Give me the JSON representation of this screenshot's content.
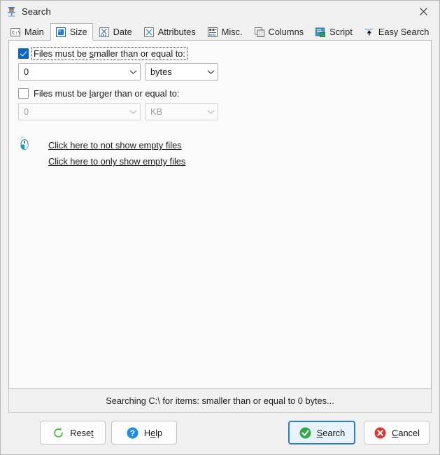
{
  "window": {
    "title": "Search",
    "icon": "search-filter-icon",
    "close_label": "×"
  },
  "tabs": [
    {
      "label": "Main",
      "icon": "console-prompt-icon",
      "selected": false
    },
    {
      "label": "Size",
      "icon": "resize-icon",
      "selected": true
    },
    {
      "label": "Date",
      "icon": "calendar-chart-icon",
      "selected": false
    },
    {
      "label": "Attributes",
      "icon": "attributes-icon",
      "selected": false
    },
    {
      "label": "Misc.",
      "icon": "misc-chart-icon",
      "selected": false
    },
    {
      "label": "Columns",
      "icon": "columns-icon",
      "selected": false
    },
    {
      "label": "Script",
      "icon": "script-icon",
      "selected": false
    },
    {
      "label": "Easy Search",
      "icon": "easy-search-icon",
      "selected": false
    }
  ],
  "size_tab": {
    "smaller": {
      "checkbox_checked": true,
      "label_pre": "Files must be ",
      "label_accel": "s",
      "label_post": "maller than or equal to:",
      "value": "0",
      "unit": "bytes",
      "enabled": true
    },
    "larger": {
      "checkbox_checked": false,
      "label_pre": "Files must be ",
      "label_accel": "l",
      "label_post": "arger than or equal to:",
      "value": "0",
      "unit": "KB",
      "enabled": false
    },
    "hints": {
      "icon": "mouse-click-icon",
      "links": [
        "Click here to not show empty files",
        "Click here to only show empty files"
      ]
    }
  },
  "status": {
    "text": "Searching C:\\ for items: smaller than or equal to 0 bytes..."
  },
  "buttons": [
    {
      "name": "reset",
      "pre": "Rese",
      "accel": "t",
      "post": "",
      "icon": "refresh-icon",
      "default": false
    },
    {
      "name": "help",
      "pre": "H",
      "accel": "e",
      "post": "lp",
      "icon": "question-icon",
      "default": false
    },
    {
      "name": "search",
      "pre": "",
      "accel": "S",
      "post": "earch",
      "icon": "check-icon",
      "default": true
    },
    {
      "name": "cancel",
      "pre": "",
      "accel": "C",
      "post": "ancel",
      "icon": "cancel-icon",
      "default": false
    }
  ],
  "colors": {
    "accent": "#0a64c8",
    "default_button_border": "#2e7ed0",
    "green": "#3aa83a",
    "red": "#e02b2b",
    "blue": "#1f8ae8",
    "teal": "#11a5ad"
  }
}
